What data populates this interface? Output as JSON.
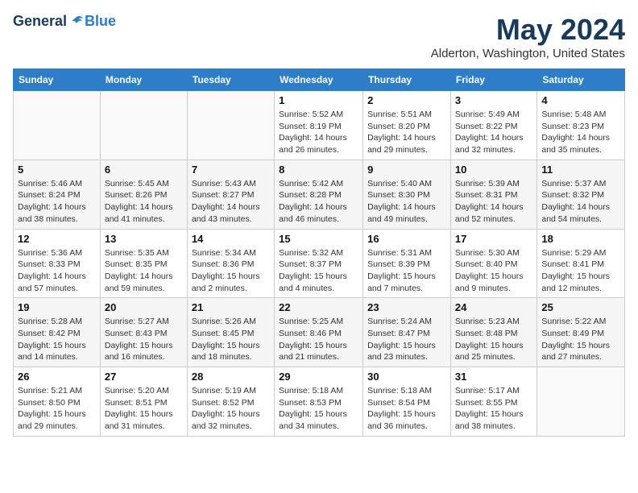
{
  "header": {
    "logo_general": "General",
    "logo_blue": "Blue",
    "month_title": "May 2024",
    "location": "Alderton, Washington, United States"
  },
  "weekdays": [
    "Sunday",
    "Monday",
    "Tuesday",
    "Wednesday",
    "Thursday",
    "Friday",
    "Saturday"
  ],
  "weeks": [
    [
      {
        "day": "",
        "info": ""
      },
      {
        "day": "",
        "info": ""
      },
      {
        "day": "",
        "info": ""
      },
      {
        "day": "1",
        "info": "Sunrise: 5:52 AM\nSunset: 8:19 PM\nDaylight: 14 hours and 26 minutes."
      },
      {
        "day": "2",
        "info": "Sunrise: 5:51 AM\nSunset: 8:20 PM\nDaylight: 14 hours and 29 minutes."
      },
      {
        "day": "3",
        "info": "Sunrise: 5:49 AM\nSunset: 8:22 PM\nDaylight: 14 hours and 32 minutes."
      },
      {
        "day": "4",
        "info": "Sunrise: 5:48 AM\nSunset: 8:23 PM\nDaylight: 14 hours and 35 minutes."
      }
    ],
    [
      {
        "day": "5",
        "info": "Sunrise: 5:46 AM\nSunset: 8:24 PM\nDaylight: 14 hours and 38 minutes."
      },
      {
        "day": "6",
        "info": "Sunrise: 5:45 AM\nSunset: 8:26 PM\nDaylight: 14 hours and 41 minutes."
      },
      {
        "day": "7",
        "info": "Sunrise: 5:43 AM\nSunset: 8:27 PM\nDaylight: 14 hours and 43 minutes."
      },
      {
        "day": "8",
        "info": "Sunrise: 5:42 AM\nSunset: 8:28 PM\nDaylight: 14 hours and 46 minutes."
      },
      {
        "day": "9",
        "info": "Sunrise: 5:40 AM\nSunset: 8:30 PM\nDaylight: 14 hours and 49 minutes."
      },
      {
        "day": "10",
        "info": "Sunrise: 5:39 AM\nSunset: 8:31 PM\nDaylight: 14 hours and 52 minutes."
      },
      {
        "day": "11",
        "info": "Sunrise: 5:37 AM\nSunset: 8:32 PM\nDaylight: 14 hours and 54 minutes."
      }
    ],
    [
      {
        "day": "12",
        "info": "Sunrise: 5:36 AM\nSunset: 8:33 PM\nDaylight: 14 hours and 57 minutes."
      },
      {
        "day": "13",
        "info": "Sunrise: 5:35 AM\nSunset: 8:35 PM\nDaylight: 14 hours and 59 minutes."
      },
      {
        "day": "14",
        "info": "Sunrise: 5:34 AM\nSunset: 8:36 PM\nDaylight: 15 hours and 2 minutes."
      },
      {
        "day": "15",
        "info": "Sunrise: 5:32 AM\nSunset: 8:37 PM\nDaylight: 15 hours and 4 minutes."
      },
      {
        "day": "16",
        "info": "Sunrise: 5:31 AM\nSunset: 8:39 PM\nDaylight: 15 hours and 7 minutes."
      },
      {
        "day": "17",
        "info": "Sunrise: 5:30 AM\nSunset: 8:40 PM\nDaylight: 15 hours and 9 minutes."
      },
      {
        "day": "18",
        "info": "Sunrise: 5:29 AM\nSunset: 8:41 PM\nDaylight: 15 hours and 12 minutes."
      }
    ],
    [
      {
        "day": "19",
        "info": "Sunrise: 5:28 AM\nSunset: 8:42 PM\nDaylight: 15 hours and 14 minutes."
      },
      {
        "day": "20",
        "info": "Sunrise: 5:27 AM\nSunset: 8:43 PM\nDaylight: 15 hours and 16 minutes."
      },
      {
        "day": "21",
        "info": "Sunrise: 5:26 AM\nSunset: 8:45 PM\nDaylight: 15 hours and 18 minutes."
      },
      {
        "day": "22",
        "info": "Sunrise: 5:25 AM\nSunset: 8:46 PM\nDaylight: 15 hours and 21 minutes."
      },
      {
        "day": "23",
        "info": "Sunrise: 5:24 AM\nSunset: 8:47 PM\nDaylight: 15 hours and 23 minutes."
      },
      {
        "day": "24",
        "info": "Sunrise: 5:23 AM\nSunset: 8:48 PM\nDaylight: 15 hours and 25 minutes."
      },
      {
        "day": "25",
        "info": "Sunrise: 5:22 AM\nSunset: 8:49 PM\nDaylight: 15 hours and 27 minutes."
      }
    ],
    [
      {
        "day": "26",
        "info": "Sunrise: 5:21 AM\nSunset: 8:50 PM\nDaylight: 15 hours and 29 minutes."
      },
      {
        "day": "27",
        "info": "Sunrise: 5:20 AM\nSunset: 8:51 PM\nDaylight: 15 hours and 31 minutes."
      },
      {
        "day": "28",
        "info": "Sunrise: 5:19 AM\nSunset: 8:52 PM\nDaylight: 15 hours and 32 minutes."
      },
      {
        "day": "29",
        "info": "Sunrise: 5:18 AM\nSunset: 8:53 PM\nDaylight: 15 hours and 34 minutes."
      },
      {
        "day": "30",
        "info": "Sunrise: 5:18 AM\nSunset: 8:54 PM\nDaylight: 15 hours and 36 minutes."
      },
      {
        "day": "31",
        "info": "Sunrise: 5:17 AM\nSunset: 8:55 PM\nDaylight: 15 hours and 38 minutes."
      },
      {
        "day": "",
        "info": ""
      }
    ]
  ]
}
